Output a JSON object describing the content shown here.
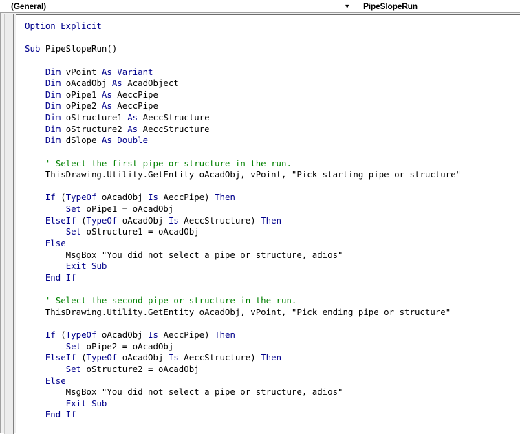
{
  "toolbar": {
    "object_combo": "(General)",
    "procedure_combo": "PipeSlopeRun",
    "dropdown_glyph": "▼",
    "dropdown_icon": "chevron-down-icon"
  },
  "colors": {
    "keyword": "#00008b",
    "comment": "#008000",
    "text": "#000000"
  },
  "code": {
    "lines": [
      [
        [
          "kw",
          "Option Explicit"
        ]
      ],
      [],
      [
        [
          "kw",
          "Sub "
        ],
        [
          "t",
          "PipeSlopeRun()"
        ]
      ],
      [],
      [
        [
          "t",
          "    "
        ],
        [
          "kw",
          "Dim "
        ],
        [
          "t",
          "vPoint "
        ],
        [
          "kw",
          "As Variant"
        ]
      ],
      [
        [
          "t",
          "    "
        ],
        [
          "kw",
          "Dim "
        ],
        [
          "t",
          "oAcadObj "
        ],
        [
          "kw",
          "As "
        ],
        [
          "t",
          "AcadObject"
        ]
      ],
      [
        [
          "t",
          "    "
        ],
        [
          "kw",
          "Dim "
        ],
        [
          "t",
          "oPipe1 "
        ],
        [
          "kw",
          "As "
        ],
        [
          "t",
          "AeccPipe"
        ]
      ],
      [
        [
          "t",
          "    "
        ],
        [
          "kw",
          "Dim "
        ],
        [
          "t",
          "oPipe2 "
        ],
        [
          "kw",
          "As "
        ],
        [
          "t",
          "AeccPipe"
        ]
      ],
      [
        [
          "t",
          "    "
        ],
        [
          "kw",
          "Dim "
        ],
        [
          "t",
          "oStructure1 "
        ],
        [
          "kw",
          "As "
        ],
        [
          "t",
          "AeccStructure"
        ]
      ],
      [
        [
          "t",
          "    "
        ],
        [
          "kw",
          "Dim "
        ],
        [
          "t",
          "oStructure2 "
        ],
        [
          "kw",
          "As "
        ],
        [
          "t",
          "AeccStructure"
        ]
      ],
      [
        [
          "t",
          "    "
        ],
        [
          "kw",
          "Dim "
        ],
        [
          "t",
          "dSlope "
        ],
        [
          "kw",
          "As Double"
        ]
      ],
      [],
      [
        [
          "t",
          "    "
        ],
        [
          "cm",
          "' Select the first pipe or structure in the run."
        ]
      ],
      [
        [
          "t",
          "    ThisDrawing.Utility.GetEntity oAcadObj, vPoint, \"Pick starting pipe or structure\""
        ]
      ],
      [],
      [
        [
          "t",
          "    "
        ],
        [
          "kw",
          "If "
        ],
        [
          "t",
          "("
        ],
        [
          "kw",
          "TypeOf "
        ],
        [
          "t",
          "oAcadObj "
        ],
        [
          "kw",
          "Is "
        ],
        [
          "t",
          "AeccPipe) "
        ],
        [
          "kw",
          "Then"
        ]
      ],
      [
        [
          "t",
          "        "
        ],
        [
          "kw",
          "Set "
        ],
        [
          "t",
          "oPipe1 = oAcadObj"
        ]
      ],
      [
        [
          "t",
          "    "
        ],
        [
          "kw",
          "ElseIf "
        ],
        [
          "t",
          "("
        ],
        [
          "kw",
          "TypeOf "
        ],
        [
          "t",
          "oAcadObj "
        ],
        [
          "kw",
          "Is "
        ],
        [
          "t",
          "AeccStructure) "
        ],
        [
          "kw",
          "Then"
        ]
      ],
      [
        [
          "t",
          "        "
        ],
        [
          "kw",
          "Set "
        ],
        [
          "t",
          "oStructure1 = oAcadObj"
        ]
      ],
      [
        [
          "t",
          "    "
        ],
        [
          "kw",
          "Else"
        ]
      ],
      [
        [
          "t",
          "        MsgBox \"You did not select a pipe or structure, adios\""
        ]
      ],
      [
        [
          "t",
          "        "
        ],
        [
          "kw",
          "Exit Sub"
        ]
      ],
      [
        [
          "t",
          "    "
        ],
        [
          "kw",
          "End If"
        ]
      ],
      [],
      [
        [
          "t",
          "    "
        ],
        [
          "cm",
          "' Select the second pipe or structure in the run."
        ]
      ],
      [
        [
          "t",
          "    ThisDrawing.Utility.GetEntity oAcadObj, vPoint, \"Pick ending pipe or structure\""
        ]
      ],
      [],
      [
        [
          "t",
          "    "
        ],
        [
          "kw",
          "If "
        ],
        [
          "t",
          "("
        ],
        [
          "kw",
          "TypeOf "
        ],
        [
          "t",
          "oAcadObj "
        ],
        [
          "kw",
          "Is "
        ],
        [
          "t",
          "AeccPipe) "
        ],
        [
          "kw",
          "Then"
        ]
      ],
      [
        [
          "t",
          "        "
        ],
        [
          "kw",
          "Set "
        ],
        [
          "t",
          "oPipe2 = oAcadObj"
        ]
      ],
      [
        [
          "t",
          "    "
        ],
        [
          "kw",
          "ElseIf "
        ],
        [
          "t",
          "("
        ],
        [
          "kw",
          "TypeOf "
        ],
        [
          "t",
          "oAcadObj "
        ],
        [
          "kw",
          "Is "
        ],
        [
          "t",
          "AeccStructure) "
        ],
        [
          "kw",
          "Then"
        ]
      ],
      [
        [
          "t",
          "        "
        ],
        [
          "kw",
          "Set "
        ],
        [
          "t",
          "oStructure2 = oAcadObj"
        ]
      ],
      [
        [
          "t",
          "    "
        ],
        [
          "kw",
          "Else"
        ]
      ],
      [
        [
          "t",
          "        MsgBox \"You did not select a pipe or structure, adios\""
        ]
      ],
      [
        [
          "t",
          "        "
        ],
        [
          "kw",
          "Exit Sub"
        ]
      ],
      [
        [
          "t",
          "    "
        ],
        [
          "kw",
          "End If"
        ]
      ]
    ]
  }
}
